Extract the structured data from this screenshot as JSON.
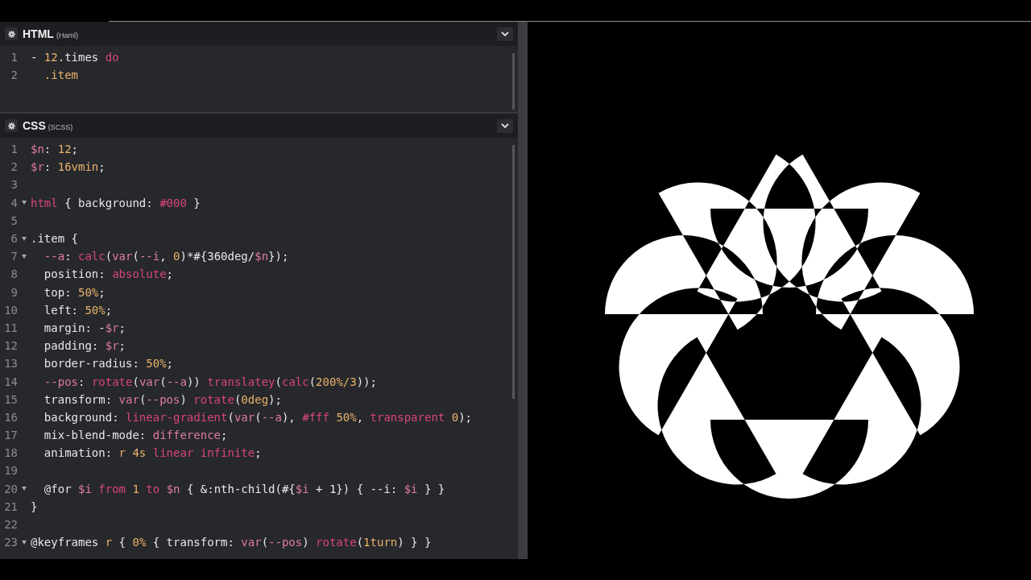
{
  "panels": [
    {
      "title": "HTML",
      "syntax": "(Haml)",
      "lines": [
        {
          "num": "1",
          "foldable": false,
          "tokens": [
            {
              "t": "- ",
              "kind": "plain"
            },
            {
              "t": "12",
              "kind": "number"
            },
            {
              "t": ".times ",
              "kind": "plain"
            },
            {
              "t": "do",
              "kind": "keyword"
            }
          ]
        },
        {
          "num": "2",
          "foldable": false,
          "tokens": [
            {
              "t": "  .item",
              "kind": "number"
            }
          ]
        }
      ]
    },
    {
      "title": "CSS",
      "syntax": "(SCSS)",
      "lines": [
        {
          "num": "1",
          "foldable": false,
          "tokens": [
            {
              "t": "$n",
              "kind": "variable"
            },
            {
              "t": ": ",
              "kind": "plain"
            },
            {
              "t": "12",
              "kind": "number"
            },
            {
              "t": ";",
              "kind": "plain"
            }
          ]
        },
        {
          "num": "2",
          "foldable": false,
          "tokens": [
            {
              "t": "$r",
              "kind": "variable"
            },
            {
              "t": ": ",
              "kind": "plain"
            },
            {
              "t": "16vmin",
              "kind": "number"
            },
            {
              "t": ";",
              "kind": "plain"
            }
          ]
        },
        {
          "num": "3",
          "foldable": false
        },
        {
          "num": "4",
          "foldable": true,
          "tokens": [
            {
              "t": "html",
              "kind": "keyword"
            },
            {
              "t": " { background: ",
              "kind": "plain"
            },
            {
              "t": "#000",
              "kind": "keyword"
            },
            {
              "t": " }",
              "kind": "plain"
            }
          ]
        },
        {
          "num": "5",
          "foldable": false
        },
        {
          "num": "6",
          "foldable": true,
          "tokens": [
            {
              "t": ".item {",
              "kind": "plain"
            }
          ]
        },
        {
          "num": "7",
          "foldable": true,
          "tokens": [
            {
              "t": "  --a",
              "kind": "variable"
            },
            {
              "t": ": ",
              "kind": "plain"
            },
            {
              "t": "calc",
              "kind": "keyword"
            },
            {
              "t": "(",
              "kind": "plain"
            },
            {
              "t": "var",
              "kind": "variable"
            },
            {
              "t": "(",
              "kind": "plain"
            },
            {
              "t": "--i",
              "kind": "variable"
            },
            {
              "t": ", ",
              "kind": "plain"
            },
            {
              "t": "0",
              "kind": "number"
            },
            {
              "t": ")*#{360deg/",
              "kind": "plain"
            },
            {
              "t": "$n",
              "kind": "variable"
            },
            {
              "t": "});",
              "kind": "plain"
            }
          ]
        },
        {
          "num": "8",
          "foldable": false,
          "tokens": [
            {
              "t": "  position: ",
              "kind": "plain"
            },
            {
              "t": "absolute",
              "kind": "keyword"
            },
            {
              "t": ";",
              "kind": "plain"
            }
          ]
        },
        {
          "num": "9",
          "foldable": false,
          "tokens": [
            {
              "t": "  top: ",
              "kind": "plain"
            },
            {
              "t": "50%",
              "kind": "number"
            },
            {
              "t": ";",
              "kind": "plain"
            }
          ]
        },
        {
          "num": "10",
          "foldable": false,
          "tokens": [
            {
              "t": "  left: ",
              "kind": "plain"
            },
            {
              "t": "50%",
              "kind": "number"
            },
            {
              "t": ";",
              "kind": "plain"
            }
          ]
        },
        {
          "num": "11",
          "foldable": false,
          "tokens": [
            {
              "t": "  margin: -",
              "kind": "plain"
            },
            {
              "t": "$r",
              "kind": "variable"
            },
            {
              "t": ";",
              "kind": "plain"
            }
          ]
        },
        {
          "num": "12",
          "foldable": false,
          "tokens": [
            {
              "t": "  padding: ",
              "kind": "plain"
            },
            {
              "t": "$r",
              "kind": "variable"
            },
            {
              "t": ";",
              "kind": "plain"
            }
          ]
        },
        {
          "num": "13",
          "foldable": false,
          "tokens": [
            {
              "t": "  border-radius: ",
              "kind": "plain"
            },
            {
              "t": "50%",
              "kind": "number"
            },
            {
              "t": ";",
              "kind": "plain"
            }
          ]
        },
        {
          "num": "14",
          "foldable": false,
          "tokens": [
            {
              "t": "  --pos",
              "kind": "variable"
            },
            {
              "t": ": ",
              "kind": "plain"
            },
            {
              "t": "rotate",
              "kind": "keyword"
            },
            {
              "t": "(",
              "kind": "plain"
            },
            {
              "t": "var",
              "kind": "variable"
            },
            {
              "t": "(",
              "kind": "plain"
            },
            {
              "t": "--a",
              "kind": "variable"
            },
            {
              "t": ")) ",
              "kind": "plain"
            },
            {
              "t": "translatey",
              "kind": "keyword"
            },
            {
              "t": "(",
              "kind": "plain"
            },
            {
              "t": "calc",
              "kind": "keyword"
            },
            {
              "t": "(",
              "kind": "plain"
            },
            {
              "t": "200%/3",
              "kind": "number"
            },
            {
              "t": "));",
              "kind": "plain"
            }
          ]
        },
        {
          "num": "15",
          "foldable": false,
          "tokens": [
            {
              "t": "  transform: ",
              "kind": "plain"
            },
            {
              "t": "var",
              "kind": "variable"
            },
            {
              "t": "(",
              "kind": "plain"
            },
            {
              "t": "--pos",
              "kind": "variable"
            },
            {
              "t": ") ",
              "kind": "plain"
            },
            {
              "t": "rotate",
              "kind": "keyword"
            },
            {
              "t": "(",
              "kind": "plain"
            },
            {
              "t": "0deg",
              "kind": "number"
            },
            {
              "t": ");",
              "kind": "plain"
            }
          ]
        },
        {
          "num": "16",
          "foldable": false,
          "tokens": [
            {
              "t": "  background: ",
              "kind": "plain"
            },
            {
              "t": "linear-gradient",
              "kind": "keyword"
            },
            {
              "t": "(",
              "kind": "plain"
            },
            {
              "t": "var",
              "kind": "variable"
            },
            {
              "t": "(",
              "kind": "plain"
            },
            {
              "t": "--a",
              "kind": "variable"
            },
            {
              "t": "), ",
              "kind": "plain"
            },
            {
              "t": "#fff ",
              "kind": "keyword"
            },
            {
              "t": "50%",
              "kind": "number"
            },
            {
              "t": ", ",
              "kind": "plain"
            },
            {
              "t": "transparent ",
              "kind": "keyword"
            },
            {
              "t": "0",
              "kind": "number"
            },
            {
              "t": ");",
              "kind": "plain"
            }
          ]
        },
        {
          "num": "17",
          "foldable": false,
          "tokens": [
            {
              "t": "  mix-blend-mode: ",
              "kind": "plain"
            },
            {
              "t": "difference",
              "kind": "variable"
            },
            {
              "t": ";",
              "kind": "plain"
            }
          ]
        },
        {
          "num": "18",
          "foldable": false,
          "tokens": [
            {
              "t": "  animation: ",
              "kind": "plain"
            },
            {
              "t": "r 4s ",
              "kind": "number"
            },
            {
              "t": "linear infinite",
              "kind": "keyword"
            },
            {
              "t": ";",
              "kind": "plain"
            }
          ]
        },
        {
          "num": "19",
          "foldable": false
        },
        {
          "num": "20",
          "foldable": true,
          "tokens": [
            {
              "t": "  @for ",
              "kind": "plain"
            },
            {
              "t": "$i ",
              "kind": "variable"
            },
            {
              "t": "from ",
              "kind": "keyword"
            },
            {
              "t": "1 ",
              "kind": "number"
            },
            {
              "t": "to ",
              "kind": "keyword"
            },
            {
              "t": "$n",
              "kind": "variable"
            },
            {
              "t": " { &:nth-child(#{",
              "kind": "plain"
            },
            {
              "t": "$i",
              "kind": "variable"
            },
            {
              "t": " + 1}) { --i: ",
              "kind": "plain"
            },
            {
              "t": "$i",
              "kind": "variable"
            },
            {
              "t": " } }",
              "kind": "plain"
            }
          ]
        },
        {
          "num": "21",
          "foldable": false,
          "tokens": [
            {
              "t": "}",
              "kind": "plain"
            }
          ]
        },
        {
          "num": "22",
          "foldable": false
        },
        {
          "num": "23",
          "foldable": true,
          "tokens": [
            {
              "t": "@keyframes ",
              "kind": "plain"
            },
            {
              "t": "r",
              "kind": "number"
            },
            {
              "t": " { ",
              "kind": "plain"
            },
            {
              "t": "0%",
              "kind": "number"
            },
            {
              "t": " { transform: ",
              "kind": "plain"
            },
            {
              "t": "var",
              "kind": "variable"
            },
            {
              "t": "(",
              "kind": "plain"
            },
            {
              "t": "--pos",
              "kind": "variable"
            },
            {
              "t": ") ",
              "kind": "plain"
            },
            {
              "t": "rotate",
              "kind": "keyword"
            },
            {
              "t": "(",
              "kind": "plain"
            },
            {
              "t": "1turn",
              "kind": "number"
            },
            {
              "t": ") } }",
              "kind": "plain"
            }
          ]
        }
      ]
    }
  ]
}
